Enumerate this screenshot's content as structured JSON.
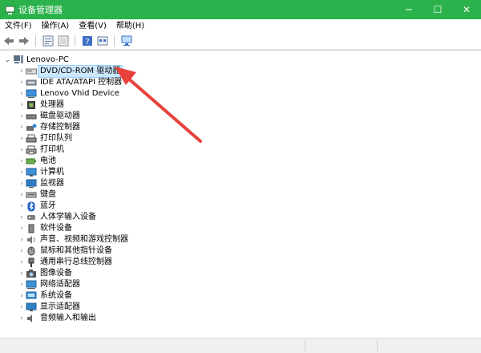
{
  "window": {
    "title": "设备管理器",
    "controls": {
      "minimize": "─",
      "maximize": "☐",
      "close": "✕"
    }
  },
  "menu": [
    {
      "label": "文件(F)"
    },
    {
      "label": "操作(A)"
    },
    {
      "label": "查看(V)"
    },
    {
      "label": "帮助(H)"
    }
  ],
  "toolbar": {
    "buttons": [
      "back-icon",
      "forward-icon",
      "properties-icon",
      "show-hidden-icon",
      "help-icon",
      "update-driver-icon",
      "scan-hardware-icon"
    ]
  },
  "tree": {
    "root": "Lenovo-PC",
    "items": [
      {
        "label": "DVD/CD-ROM 驱动器",
        "icon": "dvd-drive-icon",
        "selected": true
      },
      {
        "label": "IDE ATA/ATAPI 控制器",
        "icon": "ide-controller-icon"
      },
      {
        "label": "Lenovo Vhid Device",
        "icon": "vhid-device-icon"
      },
      {
        "label": "处理器",
        "icon": "processor-icon"
      },
      {
        "label": "磁盘驱动器",
        "icon": "disk-drive-icon"
      },
      {
        "label": "存储控制器",
        "icon": "storage-controller-icon"
      },
      {
        "label": "打印队列",
        "icon": "print-queue-icon"
      },
      {
        "label": "打印机",
        "icon": "printer-icon"
      },
      {
        "label": "电池",
        "icon": "battery-icon"
      },
      {
        "label": "计算机",
        "icon": "computer-icon"
      },
      {
        "label": "监视器",
        "icon": "monitor-icon"
      },
      {
        "label": "键盘",
        "icon": "keyboard-icon"
      },
      {
        "label": "蓝牙",
        "icon": "bluetooth-icon"
      },
      {
        "label": "人体学输入设备",
        "icon": "hid-icon"
      },
      {
        "label": "软件设备",
        "icon": "software-device-icon"
      },
      {
        "label": "声音、视频和游戏控制器",
        "icon": "sound-icon"
      },
      {
        "label": "鼠标和其他指针设备",
        "icon": "mouse-icon"
      },
      {
        "label": "通用串行总线控制器",
        "icon": "usb-icon"
      },
      {
        "label": "图像设备",
        "icon": "imaging-icon"
      },
      {
        "label": "网络适配器",
        "icon": "network-adapter-icon"
      },
      {
        "label": "系统设备",
        "icon": "system-device-icon"
      },
      {
        "label": "显示适配器",
        "icon": "display-adapter-icon"
      },
      {
        "label": "音频输入和输出",
        "icon": "audio-io-icon"
      }
    ]
  },
  "colors": {
    "titlebar": "#2bb24c",
    "selection": "#cce8ff",
    "arrow": "#e8413c"
  }
}
